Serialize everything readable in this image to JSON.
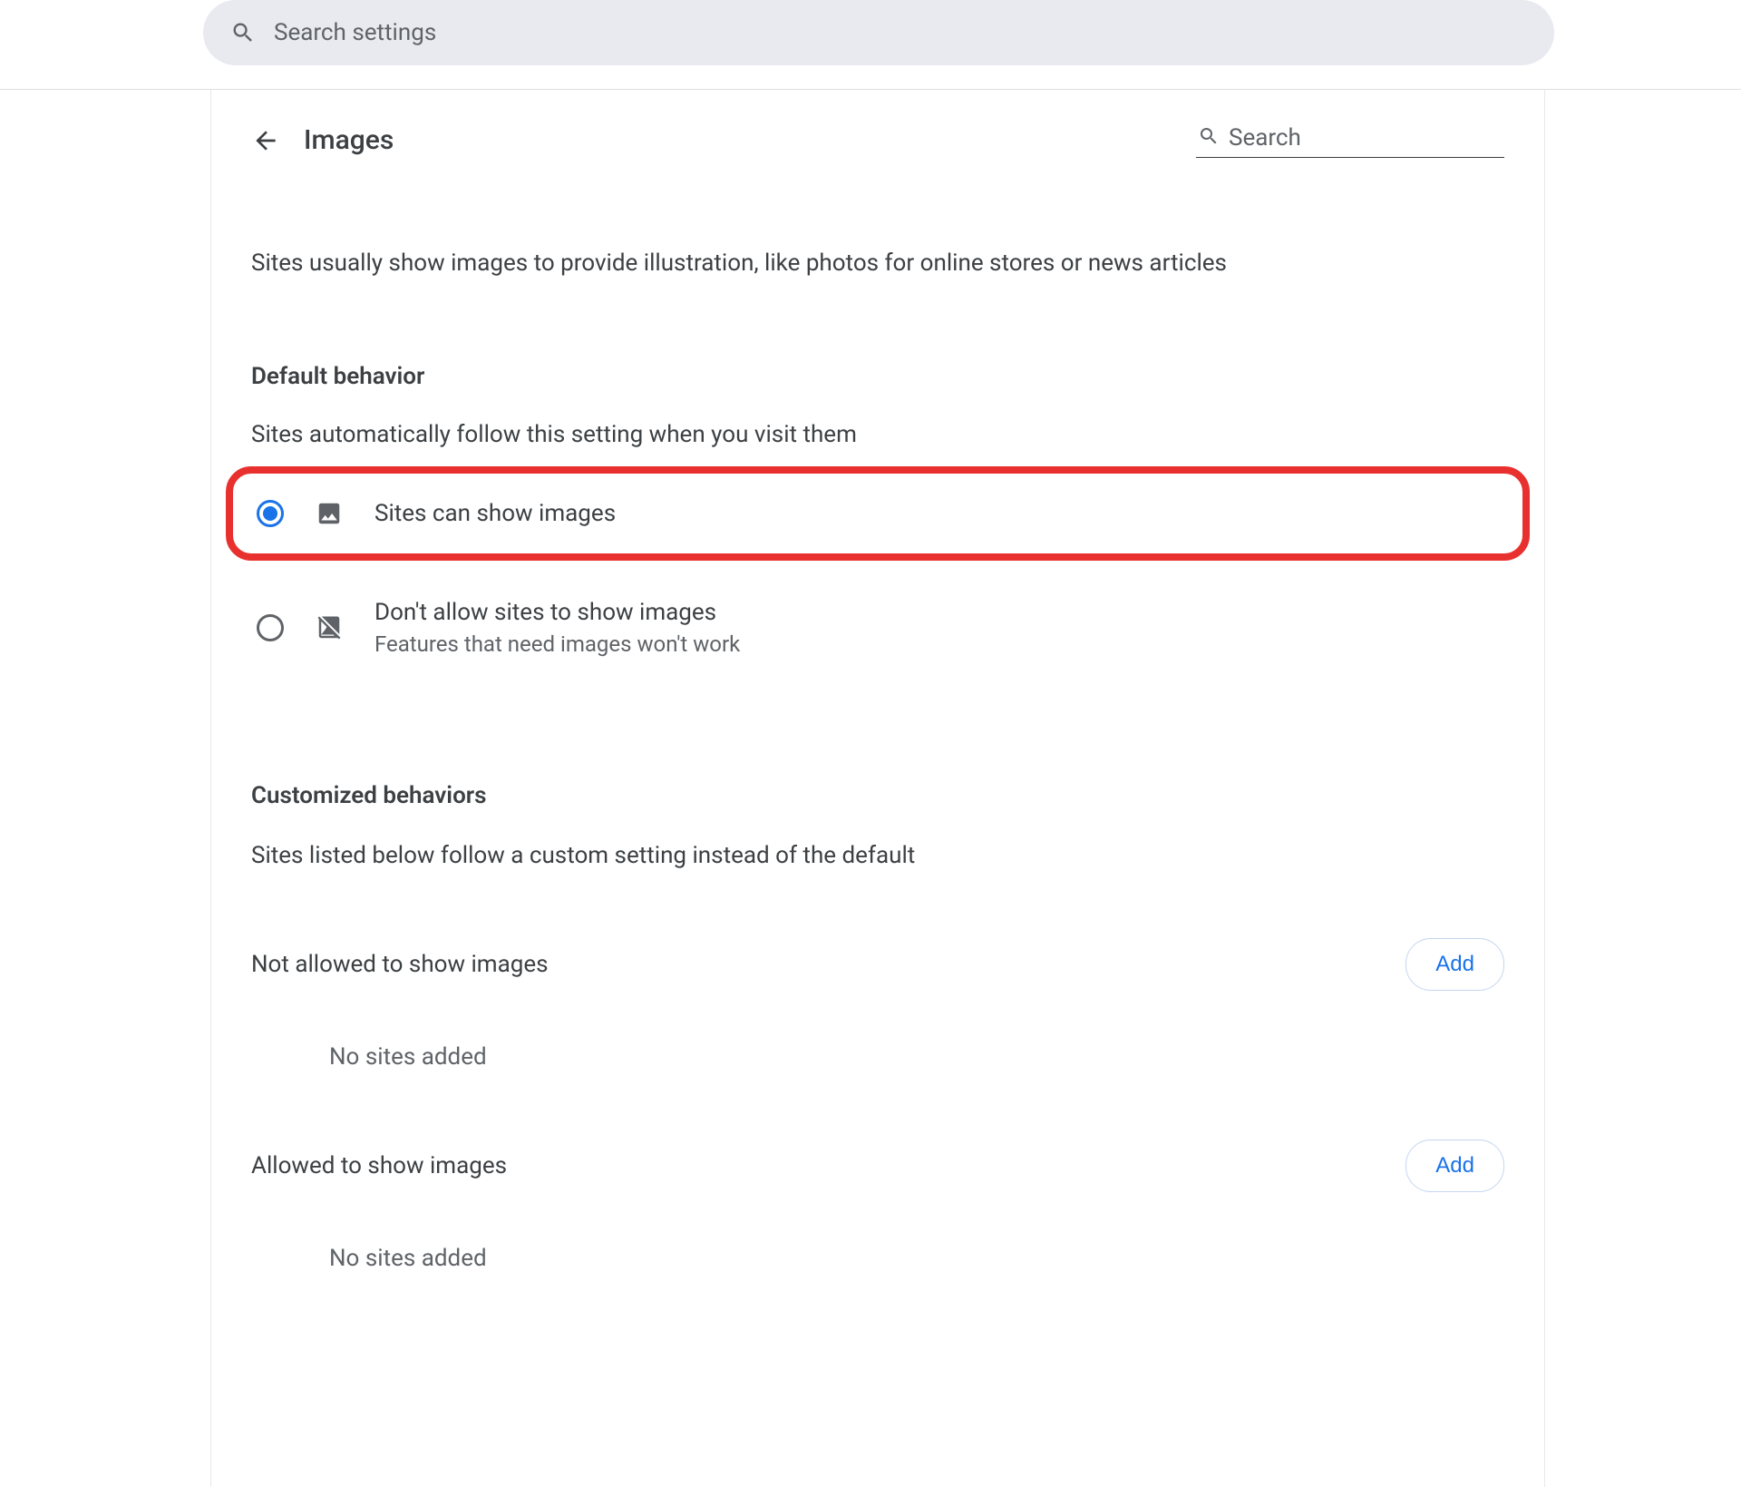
{
  "global_search": {
    "placeholder": "Search settings"
  },
  "header": {
    "title": "Images",
    "search_placeholder": "Search"
  },
  "intro": "Sites usually show images to provide illustration, like photos for online stores or news articles",
  "default_behavior": {
    "title": "Default behavior",
    "subtitle": "Sites automatically follow this setting when you visit them",
    "options": [
      {
        "label": "Sites can show images",
        "sub": "",
        "selected": true,
        "highlighted": true
      },
      {
        "label": "Don't allow sites to show images",
        "sub": "Features that need images won't work",
        "selected": false,
        "highlighted": false
      }
    ]
  },
  "customized": {
    "title": "Customized behaviors",
    "subtitle": "Sites listed below follow a custom setting instead of the default",
    "blocks": [
      {
        "label": "Not allowed to show images",
        "add": "Add",
        "empty": "No sites added"
      },
      {
        "label": "Allowed to show images",
        "add": "Add",
        "empty": "No sites added"
      }
    ]
  }
}
